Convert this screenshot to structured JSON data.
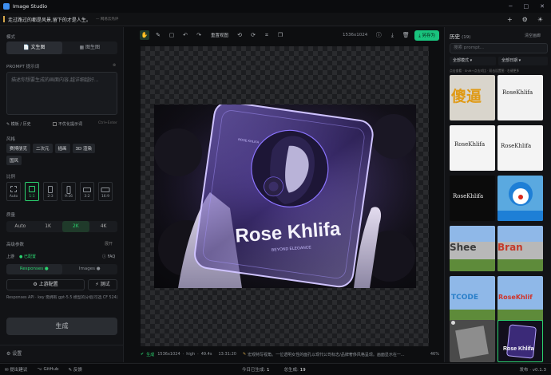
{
  "window": {
    "title": "Image Studio"
  },
  "quote": {
    "text": "走过路过的都是风景,留下的才是人生。",
    "source": "— 网易云热评"
  },
  "left": {
    "mode_label": "模式",
    "mode_tabs": [
      "文生图",
      "图生图"
    ],
    "prompt_label": "PROMPT 提示词",
    "prompt_placeholder": "描述你想要生成的画面内容,越详细越好...",
    "template_btn": "模板 / 历史",
    "no_optimize": "不优化提示词",
    "shortcut": "Ctrl+Enter",
    "style_label": "风格",
    "styles": [
      "赛博朋克",
      "二次元",
      "插画",
      "3D 渲染",
      "国风"
    ],
    "ratio_label": "比例",
    "ratios": [
      "Auto",
      "1:1",
      "2:3",
      "9:16",
      "3:2",
      "16:9"
    ],
    "quality_label": "质量",
    "qualities": [
      "Auto",
      "1K",
      "2K",
      "4K"
    ],
    "advanced_label": "高级参数",
    "advanced_toggle": "展开",
    "upstream_label": "上游",
    "upstream_status": "已配置",
    "faq": "FAQ",
    "api_tabs": [
      "Responses",
      "Images"
    ],
    "config_btn": "上游配置",
    "test_btn": "测试",
    "api_note": "Responses API · key 需拥有 gpt-5.5 模型的分组(可选 CF 524)",
    "generate_btn": "生成",
    "settings": "设置"
  },
  "toolbar": {
    "fit_view": "重置视图",
    "size": "1536x1024",
    "save_as": "另存为"
  },
  "canvas": {
    "image_text": "Rose Khlifa",
    "image_subtext": "BEYOND ELEGANCE",
    "card_small": "ROSE KHLIFA"
  },
  "status": {
    "state": "生成",
    "dims": "1536x1024",
    "quality": "high",
    "duration": "49.4s",
    "time": "13:31:20",
    "prompt": "宏观特写视角。一位透明女性的面孔以现代公司标志/品牌奢侈风格呈现。画面显示在一...",
    "zoom": "46%"
  },
  "right": {
    "history_label": "历史",
    "count": "(19)",
    "clear": "清空画廊",
    "search_placeholder": "搜索 prompt...",
    "filter_mode": "全部模式",
    "filter_date": "全部日期",
    "hint": "点击查看 · Shift+点击对比 · 双击设置图 · 右键更多",
    "thumbs": [
      "傻逼",
      "RoseKhlifa",
      "RoseKhlifa",
      "RoseKhlifa",
      "RoseKhlifa",
      "",
      "RoseKhlifa",
      "",
      "Shee",
      "Bran",
      "TCODE",
      "RoseKhlif",
      "",
      "Rose Khlifa"
    ]
  },
  "footer": {
    "feedback_items": [
      "提出建议",
      "GitHub",
      "反馈"
    ],
    "today_label": "今日已生成:",
    "today": "1",
    "total_label": "总生成:",
    "total": "19",
    "version_label": "发布",
    "version": "v0.1.3"
  },
  "colors": {
    "accent": "#2bd36f",
    "save": "#19c37d"
  }
}
